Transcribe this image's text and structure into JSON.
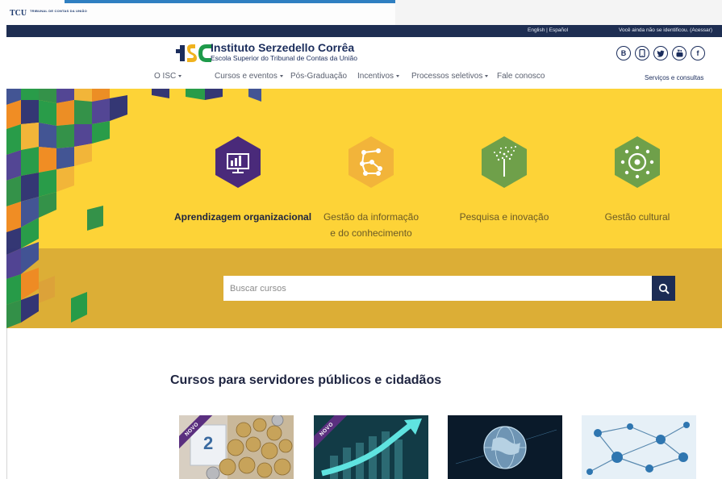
{
  "tcu": {
    "logo_text": "TCU",
    "org_name": "TRIBUNAL DE CONTAS DA UNIÃO"
  },
  "topbar": {
    "language_links": "English | Español",
    "login_text": "Você ainda não se identificou. (Acessar)"
  },
  "header": {
    "logo_text": "ISC",
    "title": "Instituto Serzedello Corrêa",
    "subtitle": "Escola Superior do Tribunal de Contas da União",
    "social_icons": [
      "blog-icon",
      "mobile-icon",
      "twitter-icon",
      "youtube-icon",
      "facebook-icon"
    ]
  },
  "nav": {
    "items": [
      {
        "label": "O ISC",
        "dropdown": true
      },
      {
        "label": "Cursos e eventos",
        "dropdown": true
      },
      {
        "label": "Pós-Graduação",
        "dropdown": false
      },
      {
        "label": "Incentivos",
        "dropdown": true
      },
      {
        "label": "Processos seletivos",
        "dropdown": true
      },
      {
        "label": "Fale conosco",
        "dropdown": false
      }
    ],
    "services": "Serviços e consultas"
  },
  "hero": {
    "areas": [
      {
        "line1": "Aprendizagem organizacional",
        "line2": "",
        "icon": "computer-chart-icon",
        "active": true
      },
      {
        "line1": "Gestão da informação",
        "line2": "e do conhecimento",
        "icon": "network-nodes-icon",
        "active": false
      },
      {
        "line1": "Pesquisa e inovação",
        "line2": "",
        "icon": "dandelion-icon",
        "active": false
      },
      {
        "line1": "Gestão cultural",
        "line2": "",
        "icon": "circle-dots-icon",
        "active": false
      }
    ],
    "search_placeholder": "Buscar cursos"
  },
  "courses": {
    "title": "Cursos para servidores públicos e cidadãos",
    "cards": [
      {
        "badge": "NOVO",
        "image": "coins-money-image"
      },
      {
        "badge": "NOVO",
        "image": "growth-arrow-image"
      },
      {
        "badge": "",
        "image": "digital-globe-image"
      },
      {
        "badge": "",
        "image": "network-connections-image"
      }
    ]
  },
  "colors": {
    "navy": "#1e2e52",
    "hero_yellow": "#fdd337",
    "hero_band": "#dcae36",
    "purple": "#4a2a7a",
    "orange_hex": "#f2b43a",
    "green_hex": "#6fa04a"
  }
}
